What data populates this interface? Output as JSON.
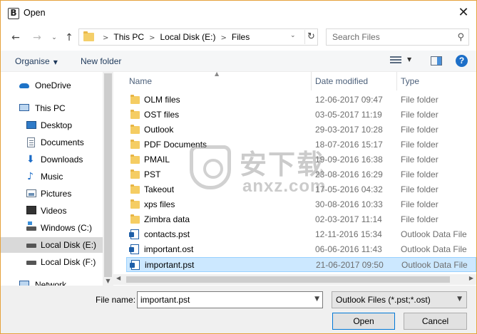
{
  "window": {
    "app_icon_letter": "B",
    "title": "Open",
    "close_glyph": "✕"
  },
  "nav": {
    "back_glyph": "←",
    "forward_glyph": "→",
    "recent_glyph": "⌄",
    "up_glyph": "↑",
    "breadcrumbs": [
      "This PC",
      "Local Disk (E:)",
      "Files"
    ],
    "separator": ">",
    "refresh_glyph": "↻",
    "search_placeholder": "Search Files",
    "search_glyph": "⚲"
  },
  "toolbar": {
    "organise_label": "Organise",
    "new_folder_label": "New folder",
    "help_label": "?"
  },
  "sidebar": {
    "items": [
      {
        "label": "OneDrive",
        "icon": "onedrive-icon"
      },
      {
        "label": "This PC",
        "icon": "this-pc-icon"
      },
      {
        "label": "Desktop",
        "icon": "desktop-icon"
      },
      {
        "label": "Documents",
        "icon": "documents-icon"
      },
      {
        "label": "Downloads",
        "icon": "downloads-icon"
      },
      {
        "label": "Music",
        "icon": "music-icon"
      },
      {
        "label": "Pictures",
        "icon": "pictures-icon"
      },
      {
        "label": "Videos",
        "icon": "videos-icon"
      },
      {
        "label": "Windows (C:)",
        "icon": "drive-c-icon"
      },
      {
        "label": "Local Disk (E:)",
        "icon": "drive-icon",
        "selected": true
      },
      {
        "label": "Local Disk (F:)",
        "icon": "drive-icon"
      },
      {
        "label": "Network",
        "icon": "network-icon"
      }
    ]
  },
  "columns": {
    "name": "Name",
    "date": "Date modified",
    "type": "Type"
  },
  "files": [
    {
      "name": "OLM files",
      "date": "12-06-2017 09:47",
      "type": "File folder",
      "kind": "folder"
    },
    {
      "name": "OST files",
      "date": "03-05-2017 11:19",
      "type": "File folder",
      "kind": "folder"
    },
    {
      "name": "Outlook",
      "date": "29-03-2017 10:28",
      "type": "File folder",
      "kind": "folder"
    },
    {
      "name": "PDF Documents",
      "date": "18-07-2016 15:17",
      "type": "File folder",
      "kind": "folder"
    },
    {
      "name": "PMAIL",
      "date": "19-09-2016 16:38",
      "type": "File folder",
      "kind": "folder"
    },
    {
      "name": "PST",
      "date": "23-08-2016 16:29",
      "type": "File folder",
      "kind": "folder"
    },
    {
      "name": "Takeout",
      "date": "17-05-2016 04:32",
      "type": "File folder",
      "kind": "folder"
    },
    {
      "name": "xps files",
      "date": "30-08-2016 10:33",
      "type": "File folder",
      "kind": "folder"
    },
    {
      "name": "Zimbra data",
      "date": "02-03-2017 11:14",
      "type": "File folder",
      "kind": "folder"
    },
    {
      "name": "contacts.pst",
      "date": "12-11-2016 15:34",
      "type": "Outlook Data File",
      "kind": "pst"
    },
    {
      "name": "important.ost",
      "date": "06-06-2016 11:43",
      "type": "Outlook Data File",
      "kind": "pst"
    },
    {
      "name": "important.pst",
      "date": "21-06-2017 09:50",
      "type": "Outlook Data File",
      "kind": "pst",
      "selected": true
    }
  ],
  "watermark": {
    "chinese": "安下载",
    "latin": "anxz.com"
  },
  "bottom": {
    "file_name_label": "File name:",
    "file_name_value": "important.pst",
    "file_type_value": "Outlook Files (*.pst;*.ost)",
    "open_label": "Open",
    "cancel_label": "Cancel"
  },
  "colors": {
    "accent": "#0078d7",
    "selection_bg": "#cce8ff",
    "selection_border": "#99d1ff",
    "folder": "#f5cd63",
    "help_blue": "#1d6fc8",
    "window_border": "#e6a23c"
  }
}
